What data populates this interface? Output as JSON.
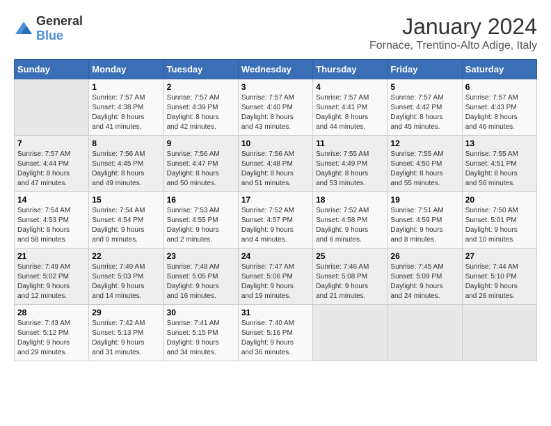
{
  "logo": {
    "text_general": "General",
    "text_blue": "Blue"
  },
  "title": "January 2024",
  "subtitle": "Fornace, Trentino-Alto Adige, Italy",
  "days_of_week": [
    "Sunday",
    "Monday",
    "Tuesday",
    "Wednesday",
    "Thursday",
    "Friday",
    "Saturday"
  ],
  "weeks": [
    [
      {
        "day": "",
        "info": ""
      },
      {
        "day": "1",
        "info": "Sunrise: 7:57 AM\nSunset: 4:38 PM\nDaylight: 8 hours\nand 41 minutes."
      },
      {
        "day": "2",
        "info": "Sunrise: 7:57 AM\nSunset: 4:39 PM\nDaylight: 8 hours\nand 42 minutes."
      },
      {
        "day": "3",
        "info": "Sunrise: 7:57 AM\nSunset: 4:40 PM\nDaylight: 8 hours\nand 43 minutes."
      },
      {
        "day": "4",
        "info": "Sunrise: 7:57 AM\nSunset: 4:41 PM\nDaylight: 8 hours\nand 44 minutes."
      },
      {
        "day": "5",
        "info": "Sunrise: 7:57 AM\nSunset: 4:42 PM\nDaylight: 8 hours\nand 45 minutes."
      },
      {
        "day": "6",
        "info": "Sunrise: 7:57 AM\nSunset: 4:43 PM\nDaylight: 8 hours\nand 46 minutes."
      }
    ],
    [
      {
        "day": "7",
        "info": "Sunrise: 7:57 AM\nSunset: 4:44 PM\nDaylight: 8 hours\nand 47 minutes."
      },
      {
        "day": "8",
        "info": "Sunrise: 7:56 AM\nSunset: 4:45 PM\nDaylight: 8 hours\nand 49 minutes."
      },
      {
        "day": "9",
        "info": "Sunrise: 7:56 AM\nSunset: 4:47 PM\nDaylight: 8 hours\nand 50 minutes."
      },
      {
        "day": "10",
        "info": "Sunrise: 7:56 AM\nSunset: 4:48 PM\nDaylight: 8 hours\nand 51 minutes."
      },
      {
        "day": "11",
        "info": "Sunrise: 7:55 AM\nSunset: 4:49 PM\nDaylight: 8 hours\nand 53 minutes."
      },
      {
        "day": "12",
        "info": "Sunrise: 7:55 AM\nSunset: 4:50 PM\nDaylight: 8 hours\nand 55 minutes."
      },
      {
        "day": "13",
        "info": "Sunrise: 7:55 AM\nSunset: 4:51 PM\nDaylight: 8 hours\nand 56 minutes."
      }
    ],
    [
      {
        "day": "14",
        "info": "Sunrise: 7:54 AM\nSunset: 4:53 PM\nDaylight: 8 hours\nand 58 minutes."
      },
      {
        "day": "15",
        "info": "Sunrise: 7:54 AM\nSunset: 4:54 PM\nDaylight: 9 hours\nand 0 minutes."
      },
      {
        "day": "16",
        "info": "Sunrise: 7:53 AM\nSunset: 4:55 PM\nDaylight: 9 hours\nand 2 minutes."
      },
      {
        "day": "17",
        "info": "Sunrise: 7:52 AM\nSunset: 4:57 PM\nDaylight: 9 hours\nand 4 minutes."
      },
      {
        "day": "18",
        "info": "Sunrise: 7:52 AM\nSunset: 4:58 PM\nDaylight: 9 hours\nand 6 minutes."
      },
      {
        "day": "19",
        "info": "Sunrise: 7:51 AM\nSunset: 4:59 PM\nDaylight: 9 hours\nand 8 minutes."
      },
      {
        "day": "20",
        "info": "Sunrise: 7:50 AM\nSunset: 5:01 PM\nDaylight: 9 hours\nand 10 minutes."
      }
    ],
    [
      {
        "day": "21",
        "info": "Sunrise: 7:49 AM\nSunset: 5:02 PM\nDaylight: 9 hours\nand 12 minutes."
      },
      {
        "day": "22",
        "info": "Sunrise: 7:49 AM\nSunset: 5:03 PM\nDaylight: 9 hours\nand 14 minutes."
      },
      {
        "day": "23",
        "info": "Sunrise: 7:48 AM\nSunset: 5:05 PM\nDaylight: 9 hours\nand 16 minutes."
      },
      {
        "day": "24",
        "info": "Sunrise: 7:47 AM\nSunset: 5:06 PM\nDaylight: 9 hours\nand 19 minutes."
      },
      {
        "day": "25",
        "info": "Sunrise: 7:46 AM\nSunset: 5:08 PM\nDaylight: 9 hours\nand 21 minutes."
      },
      {
        "day": "26",
        "info": "Sunrise: 7:45 AM\nSunset: 5:09 PM\nDaylight: 9 hours\nand 24 minutes."
      },
      {
        "day": "27",
        "info": "Sunrise: 7:44 AM\nSunset: 5:10 PM\nDaylight: 9 hours\nand 26 minutes."
      }
    ],
    [
      {
        "day": "28",
        "info": "Sunrise: 7:43 AM\nSunset: 5:12 PM\nDaylight: 9 hours\nand 29 minutes."
      },
      {
        "day": "29",
        "info": "Sunrise: 7:42 AM\nSunset: 5:13 PM\nDaylight: 9 hours\nand 31 minutes."
      },
      {
        "day": "30",
        "info": "Sunrise: 7:41 AM\nSunset: 5:15 PM\nDaylight: 9 hours\nand 34 minutes."
      },
      {
        "day": "31",
        "info": "Sunrise: 7:40 AM\nSunset: 5:16 PM\nDaylight: 9 hours\nand 36 minutes."
      },
      {
        "day": "",
        "info": ""
      },
      {
        "day": "",
        "info": ""
      },
      {
        "day": "",
        "info": ""
      }
    ]
  ]
}
